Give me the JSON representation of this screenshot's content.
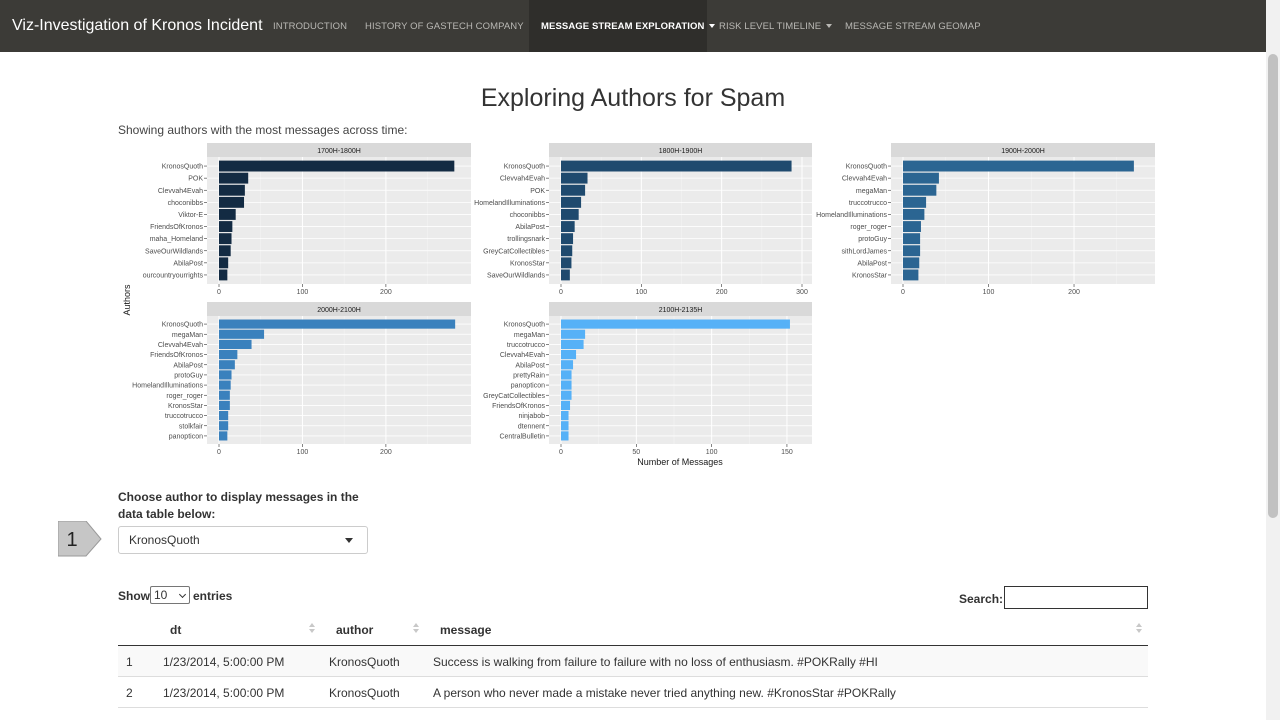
{
  "navbar": {
    "brand": "Viz-Investigation of Kronos Incident",
    "items": [
      {
        "label": "INTRODUCTION",
        "dropdown": false,
        "active": false
      },
      {
        "label": "HISTORY OF GASTECH COMPANY",
        "dropdown": true,
        "active": false
      },
      {
        "label": "MESSAGE STREAM EXPLORATION",
        "dropdown": true,
        "active": true
      },
      {
        "label": "RISK LEVEL TIMELINE",
        "dropdown": true,
        "active": false
      },
      {
        "label": "MESSAGE STREAM GEOMAP",
        "dropdown": false,
        "active": false
      }
    ]
  },
  "page": {
    "title": "Exploring Authors for Spam",
    "subtitle": "Showing authors with the most messages across time:"
  },
  "chart_data": {
    "type": "bar",
    "orientation": "horizontal",
    "xlabel": "Number of Messages",
    "ylabel": "Authors",
    "panels": [
      {
        "title": "1700H-1800H",
        "color": "#132b43",
        "xlim": [
          0,
          290
        ],
        "ticks": [
          0,
          100,
          200
        ],
        "categories": [
          "KronosQuoth",
          "POK",
          "Clevvah4Evah",
          "choconibbs",
          "Viktor-E",
          "FriendsOfKronos",
          "maha_Homeland",
          "SaveOurWildlands",
          "AbilaPost",
          "ourcountryourrights"
        ],
        "values": [
          282,
          35,
          31,
          30,
          20,
          16,
          15,
          14,
          11,
          10
        ]
      },
      {
        "title": "1800H-1900H",
        "color": "#1f4a6e",
        "xlim": [
          0,
          300
        ],
        "ticks": [
          0,
          100,
          200,
          300
        ],
        "categories": [
          "KronosQuoth",
          "Clevvah4Evah",
          "POK",
          "HomelandIlluminations",
          "choconibbs",
          "AbilaPost",
          "trollingsnark",
          "GreyCatCollectibles",
          "KronosStar",
          "SaveOurWildlands"
        ],
        "values": [
          287,
          33,
          30,
          25,
          22,
          17,
          15,
          14,
          13,
          11
        ]
      },
      {
        "title": "1900H-2000H",
        "color": "#2b6592",
        "xlim": [
          0,
          283
        ],
        "ticks": [
          0,
          100,
          200
        ],
        "categories": [
          "KronosQuoth",
          "Clevvah4Evah",
          "megaMan",
          "truccotrucco",
          "HomelandIlluminations",
          "roger_roger",
          "protoGuy",
          "sithLordJames",
          "AbilaPost",
          "KronosStar"
        ],
        "values": [
          270,
          42,
          39,
          27,
          25,
          21,
          20,
          20,
          19,
          18
        ]
      },
      {
        "title": "2000H-2100H",
        "color": "#3a81bd",
        "xlim": [
          0,
          290
        ],
        "ticks": [
          0,
          100,
          200
        ],
        "categories": [
          "KronosQuoth",
          "megaMan",
          "Clevvah4Evah",
          "FriendsOfKronos",
          "AbilaPost",
          "protoGuy",
          "HomelandIlluminations",
          "roger_roger",
          "KronosStar",
          "truccotrucco",
          "stolkfair",
          "panopticon"
        ],
        "values": [
          283,
          54,
          39,
          22,
          19,
          15,
          14,
          13,
          13,
          11,
          11,
          10
        ]
      },
      {
        "title": "2100H-2135H",
        "color": "#56b1f7",
        "xlim": [
          0,
          160
        ],
        "ticks": [
          0,
          50,
          100,
          150
        ],
        "categories": [
          "KronosQuoth",
          "megaMan",
          "truccotrucco",
          "Clevvah4Evah",
          "AbilaPost",
          "prettyRain",
          "panopticon",
          "GreyCatCollectibles",
          "FriendsOfKronos",
          "ninjabob",
          "dtennent",
          "CentralBulletin"
        ],
        "values": [
          152,
          16,
          15,
          10,
          8,
          7,
          7,
          7,
          6,
          5,
          5,
          5
        ]
      }
    ]
  },
  "author_select": {
    "label": "Choose author to display messages in the data table below:",
    "value": "KronosQuoth",
    "step_number": "1"
  },
  "table_controls": {
    "show_label": "Show",
    "length_value": "10",
    "entries_label": "entries",
    "search_label": "Search:"
  },
  "table": {
    "columns": [
      "",
      "dt",
      "author",
      "message"
    ],
    "rows": [
      {
        "index": "1",
        "dt": "1/23/2014, 5:00:00 PM",
        "author": "KronosQuoth",
        "message": "Success is walking from failure to failure with no loss of enthusiasm. #POKRally #HI"
      },
      {
        "index": "2",
        "dt": "1/23/2014, 5:00:00 PM",
        "author": "KronosQuoth",
        "message": "A person who never made a mistake never tried anything new. #KronosStar #POKRally"
      }
    ]
  }
}
